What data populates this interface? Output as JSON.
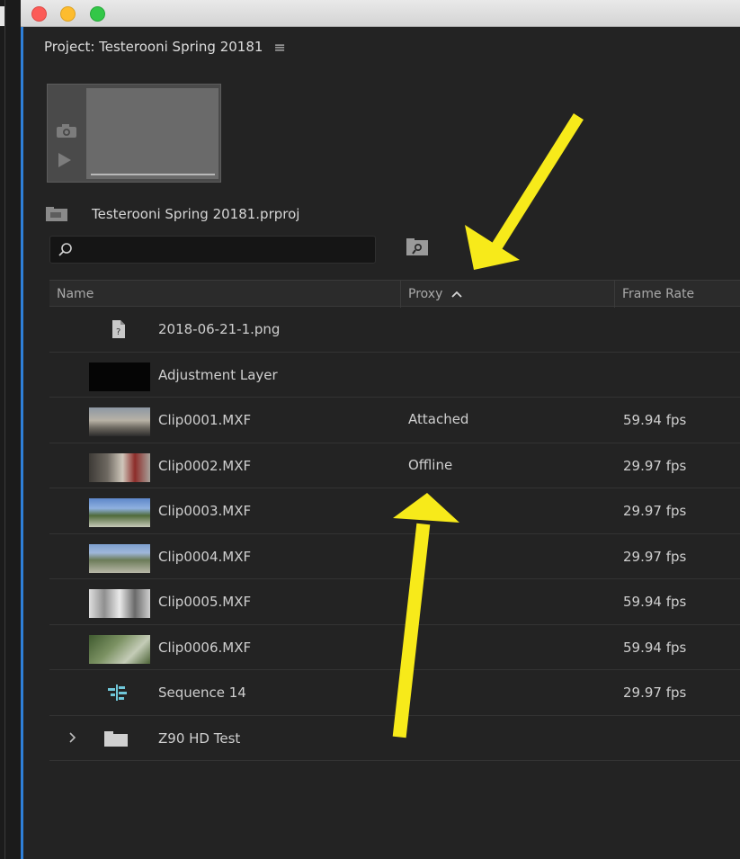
{
  "panel": {
    "title": "Project: Testerooni Spring 20181",
    "project_file": "Testerooni Spring 20181.prproj"
  },
  "search": {
    "value": "",
    "placeholder": ""
  },
  "columns": {
    "name": "Name",
    "proxy": "Proxy",
    "frame_rate": "Frame Rate"
  },
  "items": [
    {
      "name": "2018-06-21-1.png",
      "proxy": "",
      "frame_rate": "",
      "kind": "image-file-icon"
    },
    {
      "name": "Adjustment Layer",
      "proxy": "",
      "frame_rate": "",
      "kind": "black-thumbnail"
    },
    {
      "name": "Clip0001.MXF",
      "proxy": "Attached",
      "frame_rate": "59.94 fps",
      "kind": "clip-thumbnail"
    },
    {
      "name": "Clip0002.MXF",
      "proxy": "Offline",
      "frame_rate": "29.97 fps",
      "kind": "clip-thumbnail"
    },
    {
      "name": "Clip0003.MXF",
      "proxy": "",
      "frame_rate": "29.97 fps",
      "kind": "clip-thumbnail"
    },
    {
      "name": "Clip0004.MXF",
      "proxy": "",
      "frame_rate": "29.97 fps",
      "kind": "clip-thumbnail"
    },
    {
      "name": "Clip0005.MXF",
      "proxy": "",
      "frame_rate": "59.94 fps",
      "kind": "clip-thumbnail"
    },
    {
      "name": "Clip0006.MXF",
      "proxy": "",
      "frame_rate": "59.94 fps",
      "kind": "clip-thumbnail"
    },
    {
      "name": "Sequence 14",
      "proxy": "",
      "frame_rate": "29.97 fps",
      "kind": "sequence-icon"
    },
    {
      "name": "Z90 HD Test",
      "proxy": "",
      "frame_rate": "",
      "kind": "folder-icon"
    }
  ],
  "colors": {
    "panel_bg": "#232323",
    "focus_border": "#2e7fd8",
    "annotation_arrow": "#f7ea1a",
    "sequence_icon": "#6fc7d9"
  }
}
